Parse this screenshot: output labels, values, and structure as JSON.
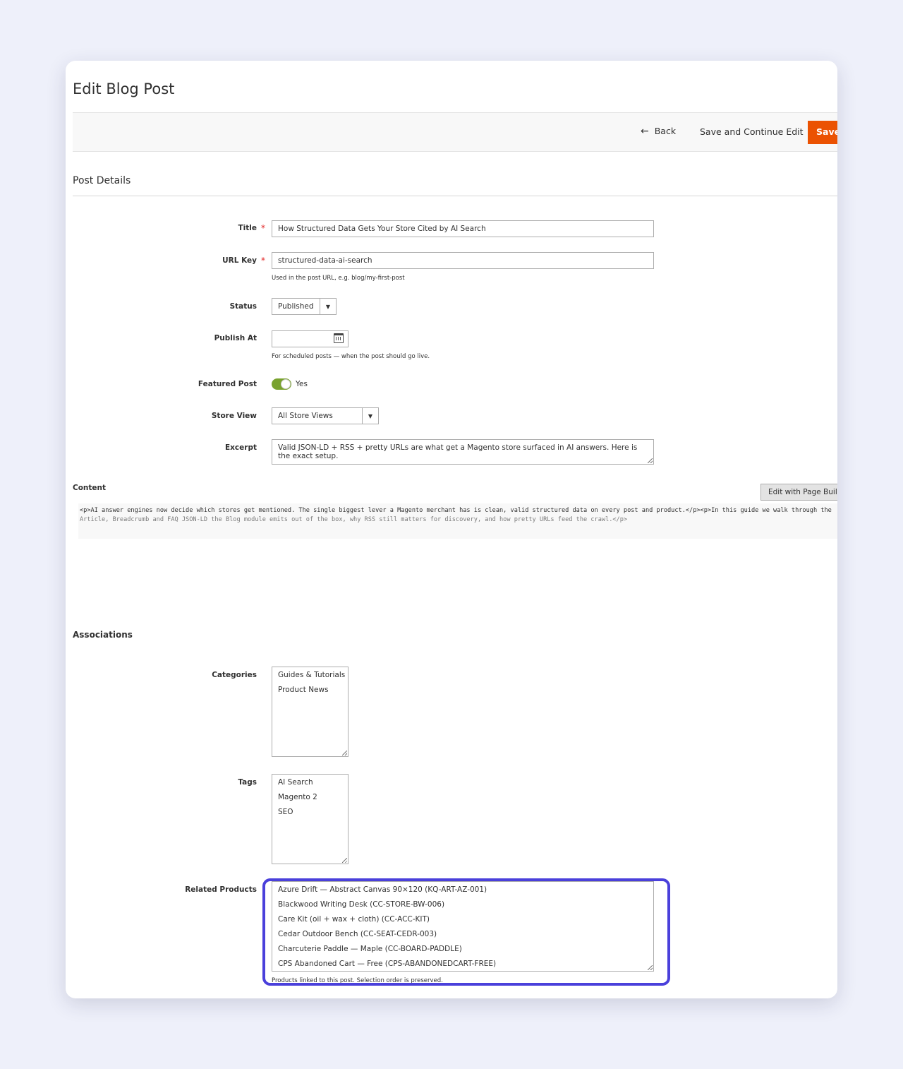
{
  "page": {
    "title": "Edit Blog Post"
  },
  "actions": {
    "back_label": "Back",
    "save_continue_label": "Save and Continue Edit",
    "save_label": "Save"
  },
  "post_details": {
    "section_title": "Post Details",
    "title": {
      "label": "Title",
      "value": "How Structured Data Gets Your Store Cited by AI Search"
    },
    "url_key": {
      "label": "URL Key",
      "value": "structured-data-ai-search",
      "note": "Used in the post URL, e.g. blog/my-first-post"
    },
    "status": {
      "label": "Status",
      "value": "Published"
    },
    "publish_at": {
      "label": "Publish At",
      "value": "",
      "note": "For scheduled posts — when the post should go live."
    },
    "featured": {
      "label": "Featured Post",
      "value": "Yes",
      "on": true
    },
    "store_view": {
      "label": "Store View",
      "value": "All Store Views"
    },
    "excerpt": {
      "label": "Excerpt",
      "value": "Valid JSON-LD + RSS + pretty URLs are what get a Magento store surfaced in AI answers. Here is the exact setup."
    }
  },
  "content": {
    "label": "Content",
    "page_builder_label": "Edit with Page Builder",
    "line1": "<p>AI answer engines now decide which stores get mentioned. The single biggest lever a Magento merchant has is clean, valid structured data on every post and product.</p><p>In this guide we walk through the",
    "line2": "Article, Breadcrumb and FAQ JSON-LD the Blog module emits out of the box, why RSS still matters for discovery, and how pretty URLs feed the crawl.</p>"
  },
  "associations": {
    "section_title": "Associations",
    "categories": {
      "label": "Categories",
      "options": [
        "Guides & Tutorials",
        "Product News"
      ]
    },
    "tags": {
      "label": "Tags",
      "options": [
        "AI Search",
        "Magento 2",
        "SEO"
      ]
    },
    "related_products": {
      "label": "Related Products",
      "options": [
        "Azure Drift — Abstract Canvas 90×120 (KQ-ART-AZ-001)",
        "Blackwood Writing Desk (CC-STORE-BW-006)",
        "Care Kit (oil + wax + cloth) (CC-ACC-KIT)",
        "Cedar Outdoor Bench (CC-SEAT-CEDR-003)",
        "Charcuterie Paddle — Maple (CC-BOARD-PADDLE)",
        "CPS Abandoned Cart — Free (CPS-ABANDONEDCART-FREE)"
      ],
      "note": "Products linked to this post. Selection order is preserved."
    }
  },
  "colors": {
    "primary_action": "#eb5202",
    "toggle_on": "#79a22e",
    "highlight": "#4a40db",
    "required": "#e22626"
  },
  "icons": [
    "arrow-left-icon",
    "calendar-icon",
    "chevron-down-icon"
  ]
}
